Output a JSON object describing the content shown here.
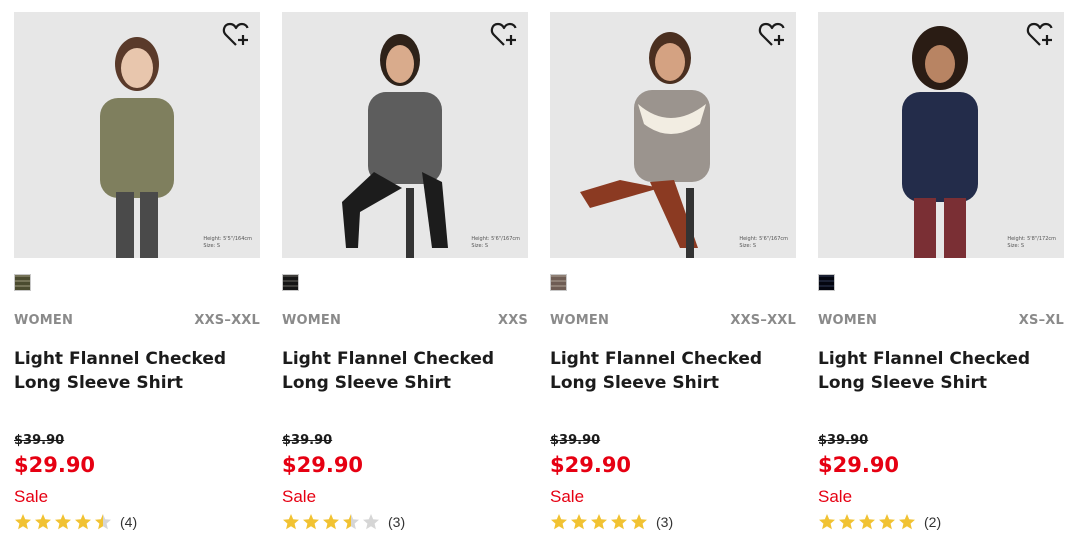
{
  "products": [
    {
      "gender": "WOMEN",
      "sizes": "XXS–XXL",
      "name": "Light Flannel Checked Long Sleeve Shirt",
      "original_price": "$39.90",
      "price": "$29.90",
      "badge": "Sale",
      "rating": 4.5,
      "review_count": "(4)",
      "photo_caption": [
        "Height: 5'5\"/164cm",
        "Size: S"
      ],
      "swatch_color": "#8a8a6e",
      "shirt_color": "#7f7f5e"
    },
    {
      "gender": "WOMEN",
      "sizes": "XXS",
      "name": "Light Flannel Checked Long Sleeve Shirt",
      "original_price": "$39.90",
      "price": "$29.90",
      "badge": "Sale",
      "rating": 3.5,
      "review_count": "(3)",
      "photo_caption": [
        "Height: 5'6\"/167cm",
        "Size: S"
      ],
      "swatch_color": "#4a4a4a",
      "shirt_color": "#5d5d5d"
    },
    {
      "gender": "WOMEN",
      "sizes": "XXS–XXL",
      "name": "Light Flannel Checked Long Sleeve Shirt",
      "original_price": "$39.90",
      "price": "$29.90",
      "badge": "Sale",
      "rating": 5,
      "review_count": "(3)",
      "photo_caption": [
        "Height: 5'6\"/167cm",
        "Size: S"
      ],
      "swatch_color": "#a89a92",
      "shirt_color": "#9b948e"
    },
    {
      "gender": "WOMEN",
      "sizes": "XS–XL",
      "name": "Light Flannel Checked Long Sleeve Shirt",
      "original_price": "$39.90",
      "price": "$29.90",
      "badge": "Sale",
      "rating": 5,
      "review_count": "(2)",
      "photo_caption": [
        "Height: 5'8\"/172cm",
        "Size: S"
      ],
      "swatch_color": "#1f2740",
      "shirt_color": "#232c4a"
    }
  ],
  "colors": {
    "sale_red": "#e60012",
    "star_gold": "#f1c232",
    "star_empty": "#d6d6d6"
  },
  "icons": {
    "favorite": "heart-plus-icon",
    "star": "star-icon"
  }
}
